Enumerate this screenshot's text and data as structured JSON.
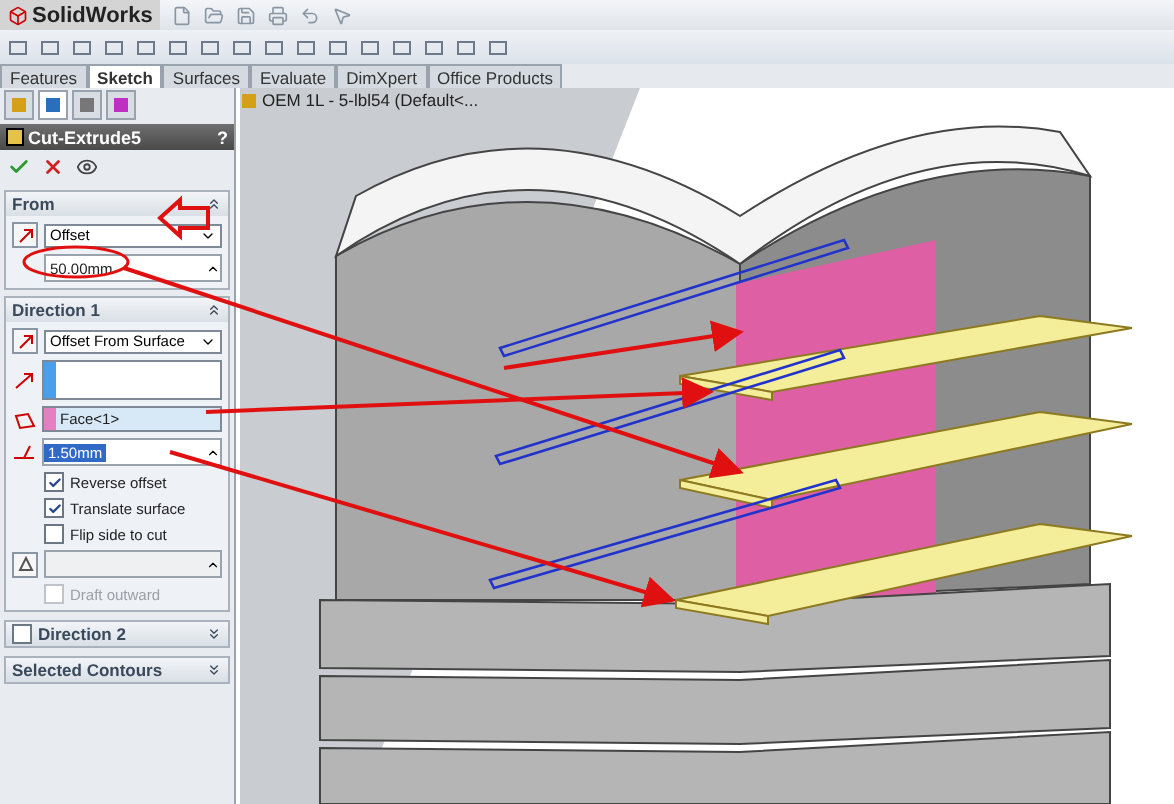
{
  "app": {
    "name": "SolidWorks"
  },
  "command_tabs": [
    {
      "label": "Features",
      "selected": false
    },
    {
      "label": "Sketch",
      "selected": true
    },
    {
      "label": "Surfaces",
      "selected": false
    },
    {
      "label": "Evaluate",
      "selected": false
    },
    {
      "label": "DimXpert",
      "selected": false
    },
    {
      "label": "Office Products",
      "selected": false
    }
  ],
  "panel_tabs": [
    {
      "selected": false
    },
    {
      "selected": true
    },
    {
      "selected": false
    },
    {
      "selected": false
    }
  ],
  "tree_root": {
    "label": "OEM 1L - 5-lbl54  (Default<..."
  },
  "property_manager": {
    "title": "Cut-Extrude5",
    "help": "?",
    "from": {
      "title": "From",
      "start_condition": "Offset",
      "offset_value": "50.00mm"
    },
    "direction1": {
      "title": "Direction 1",
      "end_condition": "Offset From Surface",
      "face": "Face<1>",
      "offset_value": "1.50mm",
      "options": [
        {
          "label": "Reverse offset",
          "checked": true,
          "disabled": false
        },
        {
          "label": "Translate surface",
          "checked": true,
          "disabled": false
        },
        {
          "label": "Flip side to cut",
          "checked": false,
          "disabled": false
        },
        {
          "label": "Draft outward",
          "checked": false,
          "disabled": true
        }
      ]
    },
    "direction2": {
      "title": "Direction 2",
      "checked": false
    },
    "selected_contours": {
      "title": "Selected Contours"
    }
  }
}
